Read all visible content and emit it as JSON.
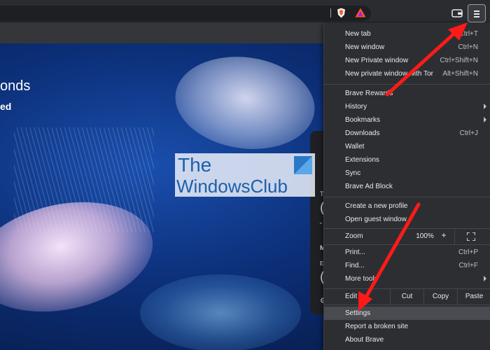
{
  "new_tab_page": {
    "headline_fragment": "onds",
    "subline_fragment": "ed",
    "card_glyphs": [
      "T",
      "(",
      "\"",
      "M",
      "E",
      "(",
      "⚙"
    ]
  },
  "watermark": {
    "line1": "The",
    "line2": "WindowsClub"
  },
  "menu": {
    "items_group1": [
      {
        "label": "New tab",
        "shortcut": "Ctrl+T"
      },
      {
        "label": "New window",
        "shortcut": "Ctrl+N"
      },
      {
        "label": "New Private window",
        "shortcut": "Ctrl+Shift+N"
      },
      {
        "label": "New private window with Tor",
        "shortcut": "Alt+Shift+N"
      }
    ],
    "items_group2": [
      {
        "label": "Brave Rewards",
        "shortcut": ""
      },
      {
        "label": "History",
        "shortcut": "",
        "submenu": true
      },
      {
        "label": "Bookmarks",
        "shortcut": "",
        "submenu": true
      },
      {
        "label": "Downloads",
        "shortcut": "Ctrl+J"
      },
      {
        "label": "Wallet",
        "shortcut": ""
      },
      {
        "label": "Extensions",
        "shortcut": ""
      },
      {
        "label": "Sync",
        "shortcut": ""
      },
      {
        "label": "Brave Ad Block",
        "shortcut": ""
      }
    ],
    "items_group3": [
      {
        "label": "Create a new profile",
        "shortcut": ""
      },
      {
        "label": "Open guest window",
        "shortcut": ""
      }
    ],
    "zoom": {
      "label": "Zoom",
      "minus": "−",
      "value": "100%",
      "plus": "+"
    },
    "items_group4": [
      {
        "label": "Print...",
        "shortcut": "Ctrl+P"
      },
      {
        "label": "Find...",
        "shortcut": "Ctrl+F"
      },
      {
        "label": "More tools",
        "shortcut": "",
        "submenu": true
      }
    ],
    "edit": {
      "label": "Edit",
      "cut": "Cut",
      "copy": "Copy",
      "paste": "Paste"
    },
    "items_group5": [
      {
        "label": "Settings",
        "shortcut": "",
        "highlighted": true
      },
      {
        "label": "Report a broken site",
        "shortcut": ""
      },
      {
        "label": "About Brave",
        "shortcut": ""
      }
    ]
  },
  "colors": {
    "menu_bg": "#2d2e31",
    "highlight": "#4a4b50",
    "annotation_arrow": "#ff1a1a",
    "brave_orange": "#fb542b"
  },
  "icons": {
    "shield": "brave-shield-icon",
    "rewards": "brave-rewards-triangle-icon",
    "wallet": "wallet-icon",
    "menu": "hamburger-menu-icon",
    "fullscreen": "fullscreen-icon"
  }
}
